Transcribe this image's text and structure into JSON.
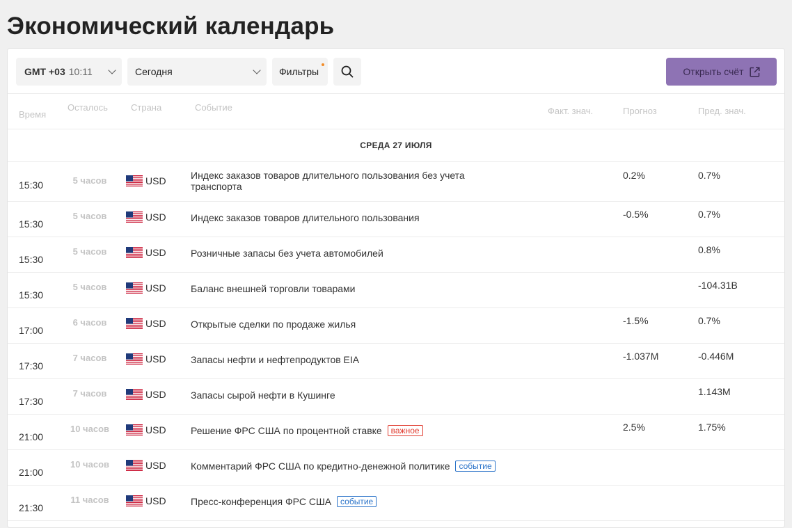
{
  "page_title": "Экономический календарь",
  "toolbar": {
    "timezone_label": "GMT +03",
    "time": "10:11",
    "period": "Сегодня",
    "filters_label": "Фильтры",
    "open_account_label": "Открыть счёт"
  },
  "columns": {
    "time": "Время",
    "remaining": "Осталось",
    "country": "Страна",
    "event": "Событие",
    "actual": "Факт. знач.",
    "forecast": "Прогноз",
    "previous": "Пред. знач."
  },
  "date_header": "СРЕДА 27 ИЮЛЯ",
  "rows": [
    {
      "time": "15:30",
      "remaining": "5 часов",
      "country": "USD",
      "event": "Индекс заказов товаров длительного пользования без учета транспорта",
      "badge": "",
      "forecast": "0.2%",
      "previous": "0.7%"
    },
    {
      "time": "15:30",
      "remaining": "5 часов",
      "country": "USD",
      "event": "Индекс заказов товаров длительного пользования",
      "badge": "",
      "forecast": "-0.5%",
      "previous": "0.7%"
    },
    {
      "time": "15:30",
      "remaining": "5 часов",
      "country": "USD",
      "event": "Розничные запасы без учета автомобилей",
      "badge": "",
      "forecast": "",
      "previous": "0.8%"
    },
    {
      "time": "15:30",
      "remaining": "5 часов",
      "country": "USD",
      "event": "Баланс внешней торговли товарами",
      "badge": "",
      "forecast": "",
      "previous": "-104.31B"
    },
    {
      "time": "17:00",
      "remaining": "6 часов",
      "country": "USD",
      "event": "Открытые сделки по продаже жилья",
      "badge": "",
      "forecast": "-1.5%",
      "previous": "0.7%"
    },
    {
      "time": "17:30",
      "remaining": "7 часов",
      "country": "USD",
      "event": "Запасы нефти и нефтепродуктов EIA",
      "badge": "",
      "forecast": "-1.037M",
      "previous": "-0.446M"
    },
    {
      "time": "17:30",
      "remaining": "7 часов",
      "country": "USD",
      "event": "Запасы сырой нефти в Кушинге",
      "badge": "",
      "forecast": "",
      "previous": "1.143M"
    },
    {
      "time": "21:00",
      "remaining": "10 часов",
      "country": "USD",
      "event": "Решение ФРС США по процентной ставке",
      "badge": "важное",
      "forecast": "2.5%",
      "previous": "1.75%"
    },
    {
      "time": "21:00",
      "remaining": "10 часов",
      "country": "USD",
      "event": "Комментарий ФРС США по кредитно-денежной политике",
      "badge": "событие",
      "forecast": "",
      "previous": ""
    },
    {
      "time": "21:30",
      "remaining": "11 часов",
      "country": "USD",
      "event": "Пресс-конференция ФРС США",
      "badge": "событие",
      "forecast": "",
      "previous": ""
    }
  ],
  "colors": {
    "accent_button": "#8e73b4",
    "badge_important": "#e03a2e",
    "badge_event": "#2a73c9",
    "filter_dot": "#f28c28"
  }
}
